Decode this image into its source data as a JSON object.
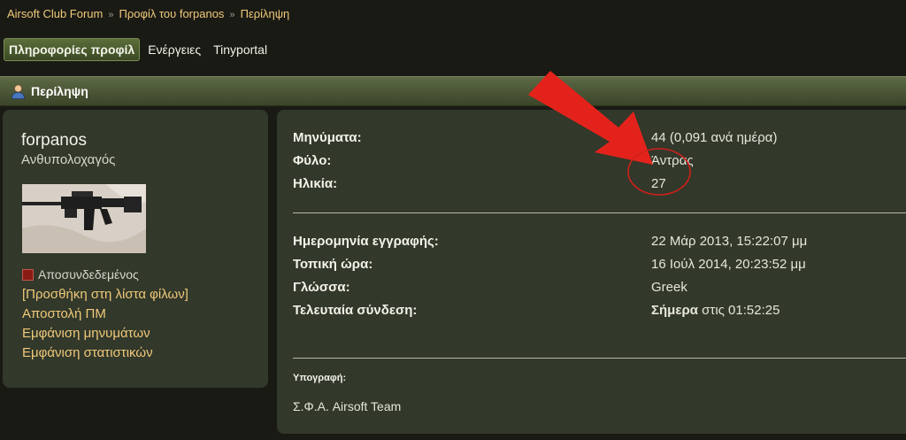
{
  "breadcrumb": {
    "items": [
      "Airsoft Club Forum",
      "Προφίλ του forpanos",
      "Περίληψη"
    ],
    "separator": "»"
  },
  "tabs": [
    "Πληροφορίες προφίλ",
    "Ενέργειες",
    "Tinyportal"
  ],
  "header": {
    "title": "Περίληψη",
    "icon": "user-icon"
  },
  "profile": {
    "username": "forpanos",
    "rank": "Ανθυπολοχαγός",
    "status": "Αποσυνδεδεμένος",
    "links": [
      "[Προσθήκη στη λίστα φίλων]",
      "Αποστολή ΠΜ",
      "Εμφάνιση μηνυμάτων",
      "Εμφάνιση στατιστικών"
    ]
  },
  "stats": {
    "posts": {
      "label": "Μηνύματα:",
      "value": "44 (0,091 ανά ημέρα)"
    },
    "gender": {
      "label": "Φύλο:",
      "value": "Άντρας"
    },
    "age": {
      "label": "Ηλικία:",
      "value": "27"
    },
    "registered": {
      "label": "Ημερομηνία εγγραφής:",
      "value": "22 Μάρ 2013, 15:22:07 μμ"
    },
    "local_time": {
      "label": "Τοπική ώρα:",
      "value": "16 Ιούλ 2014, 20:23:52 μμ"
    },
    "language": {
      "label": "Γλώσσα:",
      "value": "Greek"
    },
    "last_active": {
      "label": "Τελευταία σύνδεση:",
      "value_bold": "Σήμερα",
      "value_rest": " στις 01:52:25"
    }
  },
  "signature": {
    "label": "Υπογραφή:",
    "text": "Σ.Φ.Α. Airsoft Team"
  },
  "colors": {
    "background": "#1a1a15",
    "panel": "#32382a",
    "header_bar": "#4d5838",
    "link": "#f0c97a",
    "annotation_red": "#e3231b",
    "offline_status": "#8a1a14"
  }
}
